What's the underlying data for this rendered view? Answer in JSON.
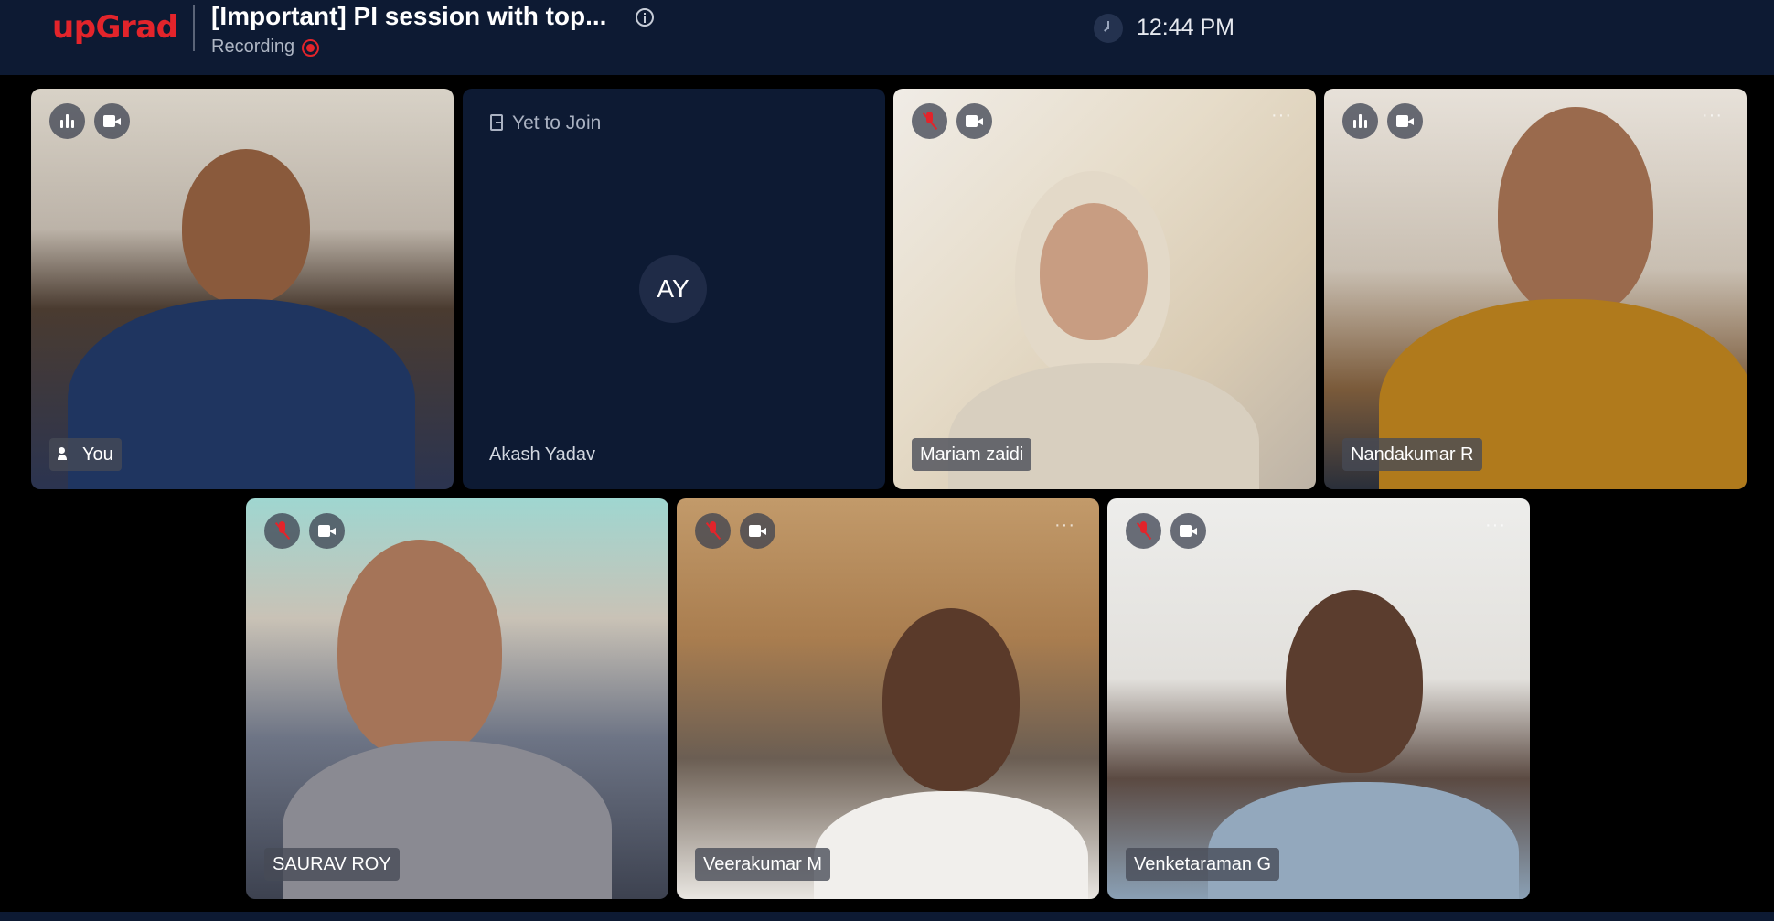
{
  "header": {
    "logo": "upGrad",
    "meeting_title": "[Important] PI session with top...",
    "recording_label": "Recording",
    "time": "12:44 PM"
  },
  "participants": [
    {
      "name": "You",
      "mic": "speaking",
      "camera": "on",
      "is_self": true
    },
    {
      "name": "Akash Yadav",
      "status": "Yet to Join",
      "initials": "AY",
      "camera": "off"
    },
    {
      "name": "Mariam zaidi",
      "mic": "muted",
      "camera": "on"
    },
    {
      "name": "Nandakumar R",
      "mic": "speaking",
      "camera": "on"
    },
    {
      "name": "SAURAV ROY",
      "mic": "muted",
      "camera": "on"
    },
    {
      "name": "Veerakumar M",
      "mic": "muted",
      "camera": "on"
    },
    {
      "name": "Venketaraman G",
      "mic": "muted",
      "camera": "on"
    }
  ],
  "colors": {
    "brand_red": "#e3242b",
    "header_bg": "#0d1a33",
    "page_bg": "#000000",
    "muted_mic": "#e3242b"
  },
  "icons": [
    "info-icon",
    "recording-icon",
    "clock-icon",
    "audio-level-icon",
    "mic-off-icon",
    "camera-icon",
    "more-icon",
    "exit-icon",
    "user-icon"
  ]
}
